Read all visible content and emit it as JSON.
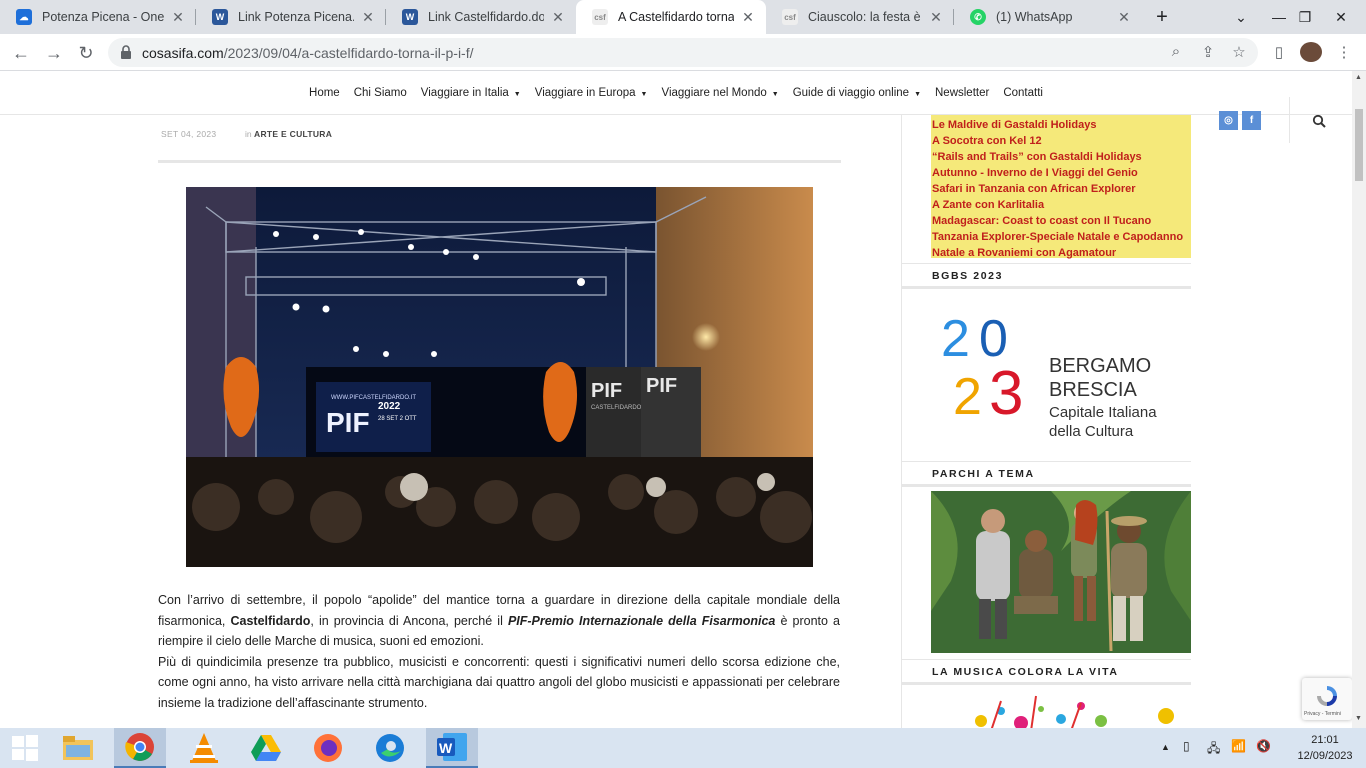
{
  "browser": {
    "tabs": [
      {
        "title": "Potenza Picena - OneD",
        "icon": "onedrive-icon",
        "active": false
      },
      {
        "title": "Link Potenza Picena.doc",
        "icon": "word-icon",
        "active": false
      },
      {
        "title": "Link Castelfidardo.docx",
        "icon": "word-icon",
        "active": false
      },
      {
        "title": "A Castelfidardo torna il",
        "icon": "csf-icon",
        "active": true
      },
      {
        "title": "Ciauscolo: la festa è a S",
        "icon": "csf-icon",
        "active": false
      },
      {
        "title": "(1) WhatsApp",
        "icon": "whatsapp-icon",
        "active": false
      }
    ],
    "new_tab": "+",
    "url_host": "cosasifa.com",
    "url_path": "/2023/09/04/a-castelfidardo-torna-il-p-i-f/"
  },
  "site": {
    "menu": [
      "Home",
      "Chi Siamo",
      "Viaggiare in Italia",
      "Viaggiare in Europa",
      "Viaggiare nel Mondo",
      "Guide di viaggio online",
      "Newsletter",
      "Contatti"
    ],
    "menu_has_caret": [
      false,
      false,
      true,
      true,
      true,
      true,
      false,
      false
    ]
  },
  "article": {
    "date": "SET 04, 2023",
    "in_label": "in",
    "category": "ARTE E CULTURA",
    "photo_text": {
      "screen_line1": "WWW.PIFCASTELFIDARDO.IT",
      "screen_logo": "PIF",
      "screen_year": "2022",
      "screen_dates": "28 SET 2 OTT",
      "banner_logo": "PIF",
      "banner_sub": "CASTELFIDARDO"
    },
    "p1_a": "Con l’arrivo di settembre, il popolo “apolide” del mantice torna a guardare in direzione della capitale mondiale della fisarmonica, ",
    "p1_b": "Castelfidardo",
    "p1_c": ", in provincia di Ancona, perché il ",
    "p1_d": "PIF-Premio Internazionale della Fisarmonica",
    "p1_e": " è pronto a riempire il cielo delle Marche di musica, suoni ed emozioni.",
    "p2": "Più di quindicimila presenze tra pubblico, musicisti e concorrenti: questi i significativi numeri dello scorsa edizione che, come ogni anno, ha visto arrivare nella città marchigiana dai quattro angoli del globo musicisti e appassionati per celebrare insieme la tradizione dell’affascinante strumento."
  },
  "sidebar": {
    "offers": [
      "Le Maldive di Gastaldi Holidays",
      "A Socotra con Kel 12",
      "“Rails and Trails” con Gastaldi Holidays",
      "Autunno - Inverno de I Viaggi del Genio",
      "Safari in Tanzania con African Explorer",
      "A Zante con Karlitalia",
      "Madagascar: Coast to coast con Il Tucano",
      "Tanzania Explorer-Speciale Natale e Capodanno",
      "Natale a Rovaniemi con Agamatour"
    ],
    "head_bgbs": "BGBS 2023",
    "bgbs_logo": {
      "digits": [
        "2",
        "0",
        "2",
        "3"
      ],
      "line1": "BERGAMO",
      "line2": "BRESCIA",
      "line3": "Capitale Italiana",
      "line4": "della Cultura"
    },
    "head_parchi": "PARCHI A TEMA",
    "head_musica": "LA MUSICA COLORA LA VITA",
    "recaptcha_label": "Privacy - Termini"
  },
  "taskbar": {
    "time": "21:01",
    "date": "12/09/2023"
  },
  "colors": {
    "offer_bg": "#f5e97a",
    "offer_text": "#c0201c",
    "tabstrip": "#dee1e6",
    "taskbar": "#d9e4f1"
  }
}
